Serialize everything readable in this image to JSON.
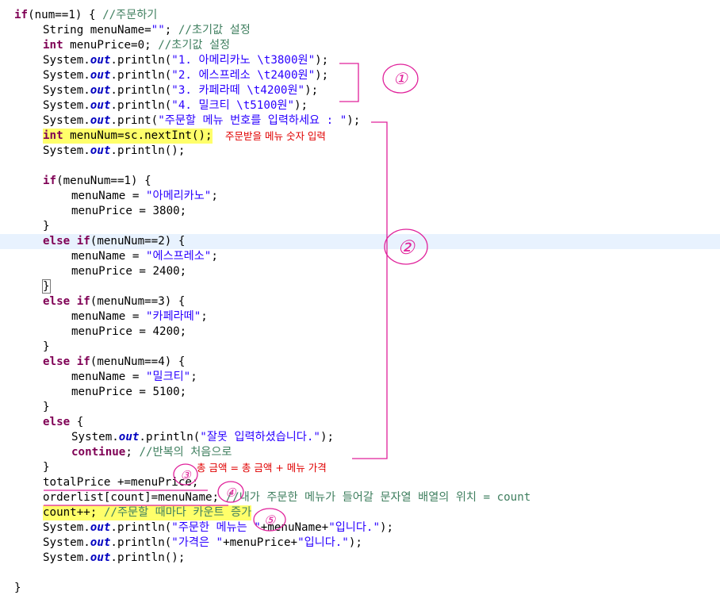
{
  "code_lines": [
    {
      "indent": 0,
      "tokens": [
        [
          "kw",
          "if"
        ],
        [
          "p",
          "(num==1) { "
        ],
        [
          "cmt",
          "//주문하기"
        ]
      ]
    },
    {
      "indent": 1,
      "tokens": [
        [
          "p",
          "String menuName="
        ],
        [
          "str",
          "\"\""
        ],
        [
          "p",
          "; "
        ],
        [
          "cmt",
          "//초기값 설정"
        ]
      ]
    },
    {
      "indent": 1,
      "tokens": [
        [
          "kw",
          "int"
        ],
        [
          "p",
          " menuPrice=0; "
        ],
        [
          "cmt",
          "//초기값 설정"
        ]
      ]
    },
    {
      "indent": 1,
      "tokens": [
        [
          "p",
          "System."
        ],
        [
          "fld",
          "out"
        ],
        [
          "p",
          ".println("
        ],
        [
          "str",
          "\"1. 아메리카노 \\t3800원\""
        ],
        [
          "p",
          ");"
        ]
      ]
    },
    {
      "indent": 1,
      "tokens": [
        [
          "p",
          "System."
        ],
        [
          "fld",
          "out"
        ],
        [
          "p",
          ".println("
        ],
        [
          "str",
          "\"2. 에스프레소 \\t2400원\""
        ],
        [
          "p",
          ");"
        ]
      ]
    },
    {
      "indent": 1,
      "tokens": [
        [
          "p",
          "System."
        ],
        [
          "fld",
          "out"
        ],
        [
          "p",
          ".println("
        ],
        [
          "str",
          "\"3. 카페라떼 \\t4200원\""
        ],
        [
          "p",
          ");"
        ]
      ]
    },
    {
      "indent": 1,
      "tokens": [
        [
          "p",
          "System."
        ],
        [
          "fld",
          "out"
        ],
        [
          "p",
          ".println("
        ],
        [
          "str",
          "\"4. 밀크티 \\t5100원\""
        ],
        [
          "p",
          ");"
        ]
      ]
    },
    {
      "indent": 1,
      "tokens": [
        [
          "p",
          "System."
        ],
        [
          "fld",
          "out"
        ],
        [
          "p",
          ".print("
        ],
        [
          "str",
          "\"주문할 메뉴 번호를 입력하세요 : \""
        ],
        [
          "p",
          ");"
        ]
      ]
    },
    {
      "indent": 1,
      "highlight": true,
      "tokens": [
        [
          "kw",
          "int"
        ],
        [
          "p",
          " menuNum=sc.nextInt();"
        ]
      ],
      "note": "주문받을 메뉴 숫자 입력"
    },
    {
      "indent": 1,
      "tokens": [
        [
          "p",
          "System."
        ],
        [
          "fld",
          "out"
        ],
        [
          "p",
          ".println();"
        ]
      ]
    },
    {
      "indent": 0,
      "tokens": []
    },
    {
      "indent": 1,
      "tokens": [
        [
          "kw",
          "if"
        ],
        [
          "p",
          "(menuNum==1) {"
        ]
      ]
    },
    {
      "indent": 2,
      "tokens": [
        [
          "p",
          "menuName = "
        ],
        [
          "str",
          "\"아메리카노\""
        ],
        [
          "p",
          ";"
        ]
      ]
    },
    {
      "indent": 2,
      "tokens": [
        [
          "p",
          "menuPrice = 3800;"
        ]
      ]
    },
    {
      "indent": 1,
      "tokens": [
        [
          "p",
          "}"
        ]
      ]
    },
    {
      "indent": 1,
      "current": true,
      "tokens": [
        [
          "kw",
          "else if"
        ],
        [
          "p",
          "(menuNum==2) {"
        ]
      ]
    },
    {
      "indent": 2,
      "tokens": [
        [
          "p",
          "menuName = "
        ],
        [
          "str",
          "\"에스프레소\""
        ],
        [
          "p",
          ";"
        ]
      ]
    },
    {
      "indent": 2,
      "tokens": [
        [
          "p",
          "menuPrice = 2400;"
        ]
      ]
    },
    {
      "indent": 1,
      "tokens": [
        [
          "box",
          "}"
        ]
      ]
    },
    {
      "indent": 1,
      "tokens": [
        [
          "kw",
          "else if"
        ],
        [
          "p",
          "(menuNum==3) {"
        ]
      ]
    },
    {
      "indent": 2,
      "tokens": [
        [
          "p",
          "menuName = "
        ],
        [
          "str",
          "\"카페라떼\""
        ],
        [
          "p",
          ";"
        ]
      ]
    },
    {
      "indent": 2,
      "tokens": [
        [
          "p",
          "menuPrice = 4200;"
        ]
      ]
    },
    {
      "indent": 1,
      "tokens": [
        [
          "p",
          "}"
        ]
      ]
    },
    {
      "indent": 1,
      "tokens": [
        [
          "kw",
          "else if"
        ],
        [
          "p",
          "(menuNum==4) {"
        ]
      ]
    },
    {
      "indent": 2,
      "tokens": [
        [
          "p",
          "menuName = "
        ],
        [
          "str",
          "\"밀크티\""
        ],
        [
          "p",
          ";"
        ]
      ]
    },
    {
      "indent": 2,
      "tokens": [
        [
          "p",
          "menuPrice = 5100;"
        ]
      ]
    },
    {
      "indent": 1,
      "tokens": [
        [
          "p",
          "}"
        ]
      ]
    },
    {
      "indent": 1,
      "tokens": [
        [
          "kw",
          "else"
        ],
        [
          "p",
          " {"
        ]
      ]
    },
    {
      "indent": 2,
      "tokens": [
        [
          "p",
          "System."
        ],
        [
          "fld",
          "out"
        ],
        [
          "p",
          ".println("
        ],
        [
          "str",
          "\"잘못 입력하셨습니다.\""
        ],
        [
          "p",
          ");"
        ]
      ]
    },
    {
      "indent": 2,
      "tokens": [
        [
          "kw",
          "continue"
        ],
        [
          "p",
          "; "
        ],
        [
          "cmt",
          "//반복의 처음으로"
        ]
      ]
    },
    {
      "indent": 1,
      "tokens": [
        [
          "p",
          "}"
        ]
      ],
      "note": "총 금액 = 총 금액 + 메뉴 가격"
    },
    {
      "indent": 1,
      "tokens": [
        [
          "p",
          "totalPrice +=menuPrice;"
        ]
      ]
    },
    {
      "indent": 1,
      "tokens": [
        [
          "p",
          "orderlist[count]=menuName; "
        ],
        [
          "cmt",
          "//내가 주문한 메뉴가 들어갈 문자열 배열의 위치 = count"
        ]
      ]
    },
    {
      "indent": 1,
      "highlight": true,
      "tokens": [
        [
          "p",
          "count++; "
        ],
        [
          "cmt",
          "//주문할 때마다 카운트 증가"
        ]
      ]
    },
    {
      "indent": 1,
      "tokens": [
        [
          "p",
          "System."
        ],
        [
          "fld",
          "out"
        ],
        [
          "p",
          ".println("
        ],
        [
          "str",
          "\"주문한 메뉴는 \""
        ],
        [
          "p",
          "+menuName+"
        ],
        [
          "str",
          "\"입니다.\""
        ],
        [
          "p",
          ");"
        ]
      ]
    },
    {
      "indent": 1,
      "tokens": [
        [
          "p",
          "System."
        ],
        [
          "fld",
          "out"
        ],
        [
          "p",
          ".println("
        ],
        [
          "str",
          "\"가격은 \""
        ],
        [
          "p",
          "+menuPrice+"
        ],
        [
          "str",
          "\"입니다.\""
        ],
        [
          "p",
          ");"
        ]
      ]
    },
    {
      "indent": 1,
      "tokens": [
        [
          "p",
          "System."
        ],
        [
          "fld",
          "out"
        ],
        [
          "p",
          ".println();"
        ]
      ]
    },
    {
      "indent": 0,
      "tokens": []
    },
    {
      "indent": 0,
      "tokens": [
        [
          "p",
          "}"
        ]
      ]
    }
  ],
  "annotations": {
    "marks": [
      "①",
      "②",
      "③",
      "④",
      "⑤"
    ],
    "pen_color": "#e0209a",
    "note_color": "#e00000",
    "highlight_color": "#ffff6a"
  },
  "colors": {
    "keyword": "#7f0055",
    "string": "#2a00ff",
    "comment": "#3f7f5f",
    "field": "#0000c0",
    "current_line": "#e8f2fe"
  }
}
